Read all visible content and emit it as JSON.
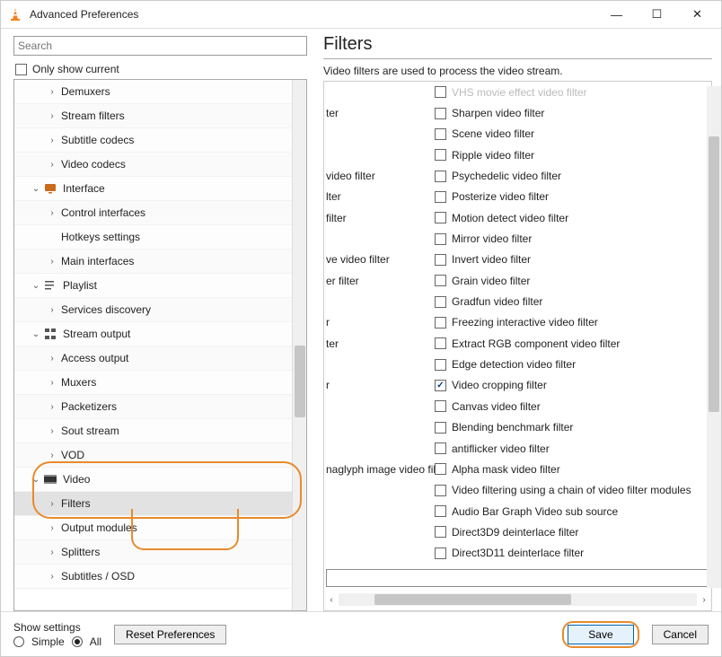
{
  "window": {
    "title": "Advanced Preferences"
  },
  "titlebar_buttons": {
    "min": "—",
    "max": "☐",
    "close": "✕"
  },
  "search": {
    "placeholder": "Search"
  },
  "only_current": {
    "label": "Only show current"
  },
  "tree": [
    {
      "label": "Demuxers",
      "chev": "r",
      "indent": true
    },
    {
      "label": "Stream filters",
      "chev": "r",
      "indent": true
    },
    {
      "label": "Subtitle codecs",
      "chev": "r",
      "indent": true
    },
    {
      "label": "Video codecs",
      "chev": "r",
      "indent": true
    },
    {
      "label": "Interface",
      "chev": "d",
      "indent": false,
      "icon": "interface"
    },
    {
      "label": "Control interfaces",
      "chev": "r",
      "indent": true
    },
    {
      "label": "Hotkeys settings",
      "chev": "",
      "indent": true
    },
    {
      "label": "Main interfaces",
      "chev": "r",
      "indent": true
    },
    {
      "label": "Playlist",
      "chev": "d",
      "indent": false,
      "icon": "playlist"
    },
    {
      "label": "Services discovery",
      "chev": "r",
      "indent": true
    },
    {
      "label": "Stream output",
      "chev": "d",
      "indent": false,
      "icon": "stream"
    },
    {
      "label": "Access output",
      "chev": "r",
      "indent": true
    },
    {
      "label": "Muxers",
      "chev": "r",
      "indent": true
    },
    {
      "label": "Packetizers",
      "chev": "r",
      "indent": true
    },
    {
      "label": "Sout stream",
      "chev": "r",
      "indent": true
    },
    {
      "label": "VOD",
      "chev": "r",
      "indent": true
    },
    {
      "label": "Video",
      "chev": "d",
      "indent": false,
      "icon": "video"
    },
    {
      "label": "Filters",
      "chev": "r",
      "indent": true,
      "selected": true
    },
    {
      "label": "Output modules",
      "chev": "r",
      "indent": true
    },
    {
      "label": "Splitters",
      "chev": "r",
      "indent": true
    },
    {
      "label": "Subtitles / OSD",
      "chev": "r",
      "indent": true
    }
  ],
  "panel": {
    "heading": "Filters",
    "description": "Video filters are used to process the video stream."
  },
  "filters": [
    {
      "left": "",
      "right": "VHS movie effect video filter",
      "dim": true
    },
    {
      "left": "ter",
      "right": "Sharpen video filter"
    },
    {
      "left": "",
      "right": "Scene video filter"
    },
    {
      "left": "",
      "right": "Ripple video filter"
    },
    {
      "left": "video filter",
      "right": "Psychedelic video filter"
    },
    {
      "left": "lter",
      "right": "Posterize video filter"
    },
    {
      "left": "filter",
      "right": "Motion detect video filter"
    },
    {
      "left": "",
      "right": "Mirror video filter"
    },
    {
      "left": "ve video filter",
      "right": "Invert video filter"
    },
    {
      "left": "er filter",
      "right": "Grain video filter"
    },
    {
      "left": "",
      "right": "Gradfun video filter"
    },
    {
      "left": "r",
      "right": "Freezing interactive video filter"
    },
    {
      "left": "ter",
      "right": "Extract RGB component video filter"
    },
    {
      "left": "",
      "right": "Edge detection video filter"
    },
    {
      "left": "r",
      "right": "Video cropping filter",
      "checked": true
    },
    {
      "left": "",
      "right": "Canvas video filter"
    },
    {
      "left": "",
      "right": "Blending benchmark filter"
    },
    {
      "left": "",
      "right": "antiflicker video filter"
    },
    {
      "left": "naglyph image video filter",
      "right": "Alpha mask video filter"
    },
    {
      "left": "",
      "right": "Video filtering using a chain of video filter modules"
    },
    {
      "left": "",
      "right": "Audio Bar Graph Video sub source"
    },
    {
      "left": "",
      "right": "Direct3D9 deinterlace filter"
    },
    {
      "left": "",
      "right": "Direct3D11 deinterlace filter"
    }
  ],
  "footer": {
    "show_settings": "Show settings",
    "simple": "Simple",
    "all": "All",
    "reset": "Reset Preferences",
    "save": "Save",
    "cancel": "Cancel"
  }
}
